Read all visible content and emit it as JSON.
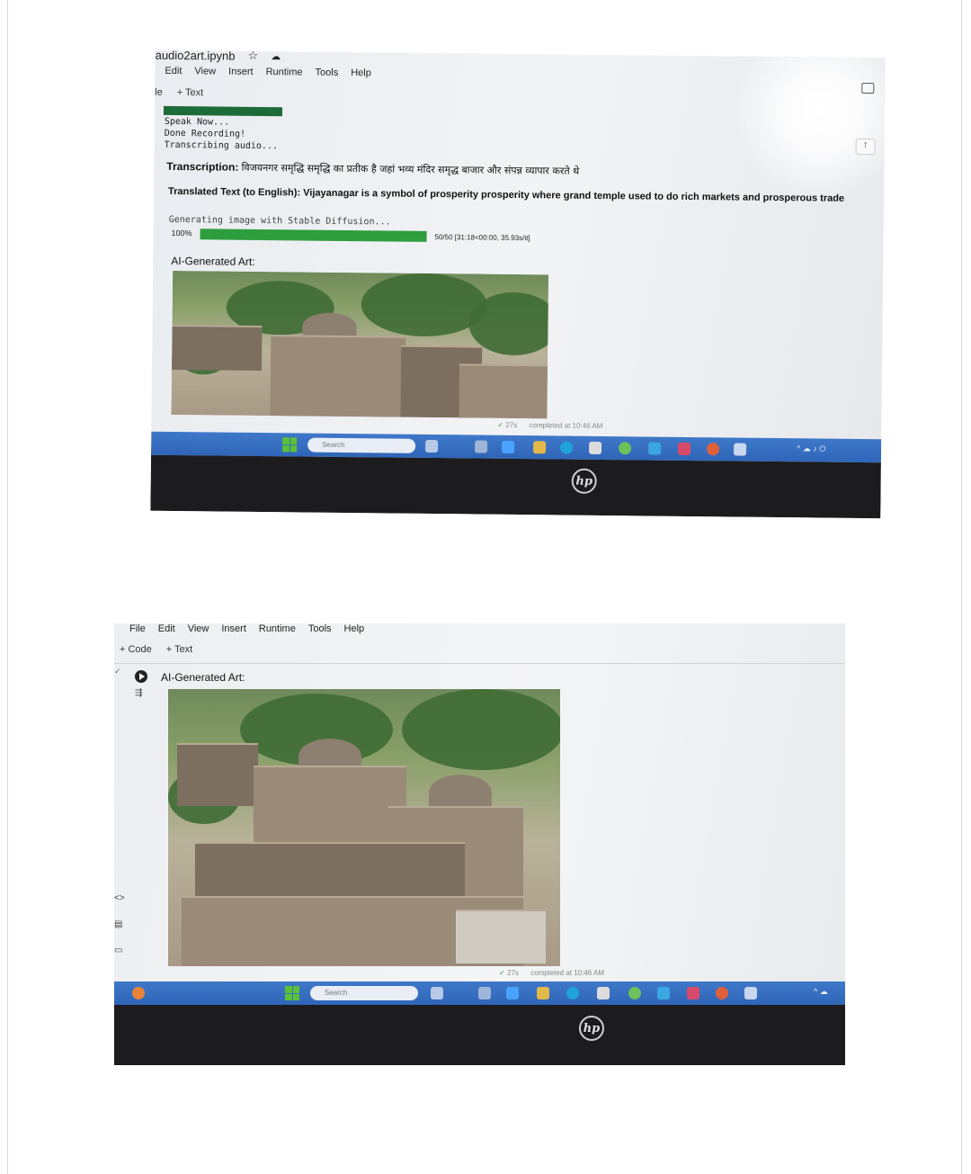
{
  "photo1": {
    "notebook_title": "audio2art.ipynb",
    "menu": [
      "Edit",
      "View",
      "Insert",
      "Runtime",
      "Tools",
      "Help"
    ],
    "toolbar_partial": "le",
    "toolbar_text": "+ Text",
    "output_lines": [
      "Speak Now...",
      "Done Recording!",
      "Transcribing audio..."
    ],
    "transcription_label": "Transcription:",
    "transcription_text": "विजयनगर समृद्धि समृद्धि का प्रतीक है जहां भव्य मंदिर समृद्ध बाजार और संपन्न व्यापार करते थे",
    "translated_label": "Translated Text (to English):",
    "translated_text": "Vijayanagar is a symbol of prosperity prosperity where grand temple used to do rich markets and prosperous trade",
    "generating": "Generating image with Stable Diffusion...",
    "progress_percent": "100%",
    "progress_fraction": 1.0,
    "progress_stats": "50/50 [31:18<00:00, 35.93s/it]",
    "art_label": "AI-Generated Art:",
    "status_time": "27s",
    "status_text": "completed at 10:46 AM",
    "search_placeholder": "Search"
  },
  "photo2": {
    "menu": [
      "File",
      "Edit",
      "View",
      "Insert",
      "Runtime",
      "Tools",
      "Help"
    ],
    "toolbar": [
      "+ Code",
      "+ Text"
    ],
    "art_label": "AI-Generated Art:",
    "status_time": "27s",
    "status_text": "completed at 10:46 AM",
    "search_placeholder": "Search"
  },
  "icons": [
    "star-icon",
    "cloud-icon",
    "comment-icon",
    "up-arrow-icon",
    "play-icon",
    "windows-icon",
    "search-icon",
    "hp-logo"
  ],
  "colors": {
    "taskbar": "#2f65b8",
    "progress": "#2e9d3e",
    "laptop_bezel": "#1c1c1e"
  }
}
